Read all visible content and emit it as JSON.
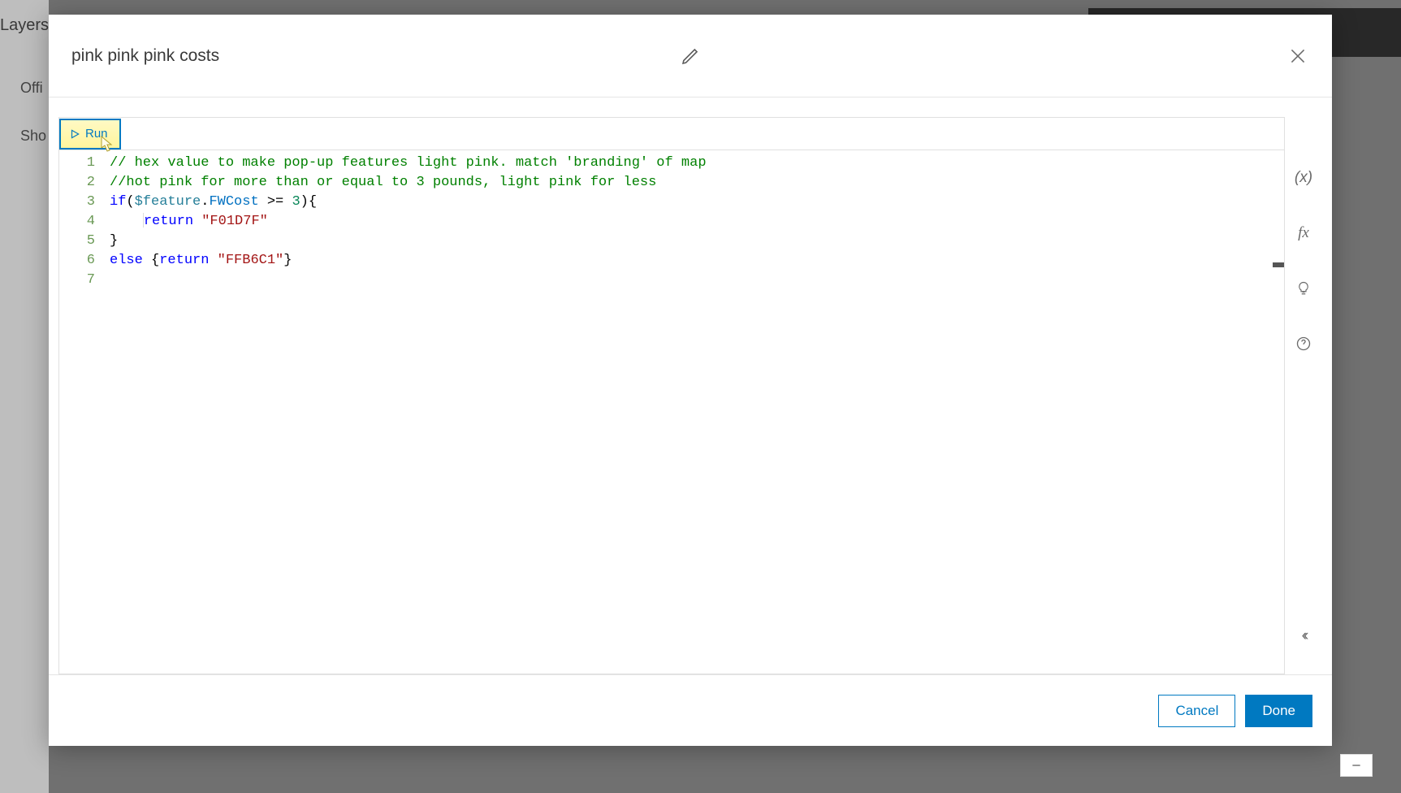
{
  "background": {
    "sidebar_title": "Layers",
    "item1": "Offi",
    "item2": "Sho"
  },
  "modal": {
    "title": "pink pink pink costs",
    "run_label": "Run",
    "cancel_label": "Cancel",
    "done_label": "Done"
  },
  "side_icons": {
    "vars": "(x)",
    "fx": "fx",
    "collapse": "‹‹"
  },
  "code": {
    "lines": [
      {
        "n": "1",
        "tokens": [
          {
            "t": "// hex value to make pop-up features light pink. match 'branding' of map",
            "c": "cm-comment"
          }
        ]
      },
      {
        "n": "2",
        "tokens": [
          {
            "t": "//hot pink for more than or equal to 3 pounds, light pink for less",
            "c": "cm-comment"
          }
        ]
      },
      {
        "n": "3",
        "tokens": [
          {
            "t": "if",
            "c": "cm-keyword"
          },
          {
            "t": "(",
            "c": "cm-punc"
          },
          {
            "t": "$feature",
            "c": "cm-feature"
          },
          {
            "t": ".",
            "c": "cm-punc"
          },
          {
            "t": "FWCost",
            "c": "cm-prop"
          },
          {
            "t": " >= ",
            "c": "cm-op"
          },
          {
            "t": "3",
            "c": "cm-num"
          },
          {
            "t": "){",
            "c": "cm-punc"
          }
        ]
      },
      {
        "n": "4",
        "indent": 4,
        "guide": true,
        "tokens": [
          {
            "t": "return",
            "c": "cm-keyword"
          },
          {
            "t": " ",
            "c": ""
          },
          {
            "t": "\"F01D7F\"",
            "c": "cm-string"
          }
        ]
      },
      {
        "n": "5",
        "tokens": [
          {
            "t": "}",
            "c": "cm-punc"
          }
        ]
      },
      {
        "n": "6",
        "tokens": [
          {
            "t": "else",
            "c": "cm-keyword"
          },
          {
            "t": " {",
            "c": "cm-punc"
          },
          {
            "t": "return",
            "c": "cm-keyword"
          },
          {
            "t": " ",
            "c": ""
          },
          {
            "t": "\"FFB6C1\"",
            "c": "cm-string"
          },
          {
            "t": "}",
            "c": "cm-punc"
          }
        ]
      },
      {
        "n": "7",
        "tokens": []
      }
    ]
  }
}
